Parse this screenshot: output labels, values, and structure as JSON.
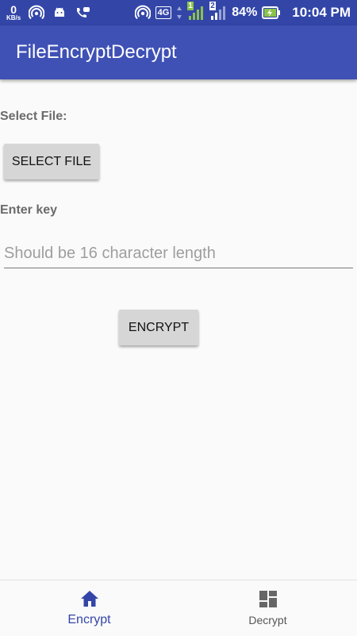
{
  "status_bar": {
    "net_speed_value": "0",
    "net_speed_unit": "KB/s",
    "network_type": "4G",
    "sim1_label": "1",
    "sim2_label": "2",
    "battery_percent": "84%",
    "time": "10:04 PM"
  },
  "app_bar": {
    "title": "FileEncryptDecrypt"
  },
  "form": {
    "select_file_label": "Select File:",
    "select_file_button": "SELECT FILE",
    "key_label": "Enter key",
    "key_placeholder": "Should be 16 character length",
    "key_value": "",
    "encrypt_button": "ENCRYPT"
  },
  "bottom_nav": {
    "items": [
      {
        "label": "Encrypt",
        "icon": "home-icon",
        "active": true
      },
      {
        "label": "Decrypt",
        "icon": "dashboard-icon",
        "active": false
      }
    ]
  },
  "colors": {
    "primary": "#3f51b5",
    "primary_dark": "#3346a8",
    "battery_charging": "#8bc34a"
  }
}
